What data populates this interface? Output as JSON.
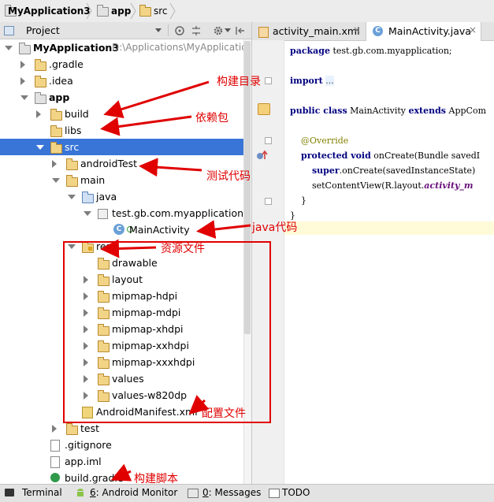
{
  "breadcrumb": [
    "MyApplication3",
    "app",
    "src"
  ],
  "panel": {
    "title": "Project"
  },
  "tree": [
    {
      "label": "MyApplication3",
      "path": "D:\\Applications\\MyApplication",
      "indent": 0,
      "arrow": "down",
      "icon": "folder-module",
      "bold": true
    },
    {
      "label": ".gradle",
      "indent": 1,
      "arrow": "right",
      "icon": "folder"
    },
    {
      "label": ".idea",
      "indent": 1,
      "arrow": "right",
      "icon": "folder"
    },
    {
      "label": "app",
      "indent": 1,
      "arrow": "down",
      "icon": "folder-module",
      "bold": true
    },
    {
      "label": "build",
      "indent": 2,
      "arrow": "right",
      "icon": "folder"
    },
    {
      "label": "libs",
      "indent": 2,
      "arrow": "none",
      "icon": "folder"
    },
    {
      "label": "src",
      "indent": 2,
      "arrow": "down",
      "icon": "folder",
      "selected": true
    },
    {
      "label": "androidTest",
      "indent": 3,
      "arrow": "right",
      "icon": "folder"
    },
    {
      "label": "main",
      "indent": 3,
      "arrow": "down",
      "icon": "folder"
    },
    {
      "label": "java",
      "indent": 4,
      "arrow": "down",
      "icon": "folder-blue"
    },
    {
      "label": "test.gb.com.myapplication",
      "indent": 5,
      "arrow": "down",
      "icon": "package"
    },
    {
      "label": "MainActivity",
      "indent": 6,
      "arrow": "none",
      "icon": "class"
    },
    {
      "label": "res",
      "indent": 4,
      "arrow": "down",
      "icon": "folder-res"
    },
    {
      "label": "drawable",
      "indent": 5,
      "arrow": "none",
      "icon": "folder"
    },
    {
      "label": "layout",
      "indent": 5,
      "arrow": "right",
      "icon": "folder"
    },
    {
      "label": "mipmap-hdpi",
      "indent": 5,
      "arrow": "right",
      "icon": "folder"
    },
    {
      "label": "mipmap-mdpi",
      "indent": 5,
      "arrow": "right",
      "icon": "folder"
    },
    {
      "label": "mipmap-xhdpi",
      "indent": 5,
      "arrow": "right",
      "icon": "folder"
    },
    {
      "label": "mipmap-xxhdpi",
      "indent": 5,
      "arrow": "right",
      "icon": "folder"
    },
    {
      "label": "mipmap-xxxhdpi",
      "indent": 5,
      "arrow": "right",
      "icon": "folder"
    },
    {
      "label": "values",
      "indent": 5,
      "arrow": "right",
      "icon": "folder"
    },
    {
      "label": "values-w820dp",
      "indent": 5,
      "arrow": "right",
      "icon": "folder"
    },
    {
      "label": "AndroidManifest.xml",
      "indent": 4,
      "arrow": "none",
      "icon": "manifest"
    },
    {
      "label": "test",
      "indent": 3,
      "arrow": "right",
      "icon": "folder"
    },
    {
      "label": ".gitignore",
      "indent": 2,
      "arrow": "none",
      "icon": "file"
    },
    {
      "label": "app.iml",
      "indent": 2,
      "arrow": "none",
      "icon": "file"
    },
    {
      "label": "build.gradle",
      "indent": 2,
      "arrow": "none",
      "icon": "gradle"
    }
  ],
  "editor": {
    "tabs": [
      {
        "label": "activity_main.xml",
        "active": false
      },
      {
        "label": "MainActivity.java",
        "active": true
      }
    ],
    "lines": [
      [
        {
          "t": "package",
          "c": "kw"
        },
        {
          "t": " test.gb.com.myapplication;"
        }
      ],
      [],
      [
        {
          "t": "import",
          "c": "kw"
        },
        {
          "t": " "
        },
        {
          "t": "...",
          "c": "fold-hint"
        }
      ],
      [],
      [
        {
          "t": "public class",
          "c": "kw"
        },
        {
          "t": " MainActivity "
        },
        {
          "t": "extends",
          "c": "kw"
        },
        {
          "t": " AppCom"
        }
      ],
      [],
      [
        {
          "t": "    @Override",
          "c": "ann"
        }
      ],
      [
        {
          "t": "    "
        },
        {
          "t": "protected void",
          "c": "kw"
        },
        {
          "t": " onCreate(Bundle savedI"
        }
      ],
      [
        {
          "t": "        "
        },
        {
          "t": "super",
          "c": "kw"
        },
        {
          "t": ".onCreate(savedInstanceState)"
        }
      ],
      [
        {
          "t": "        setContentView(R.layout."
        },
        {
          "t": "activity_m",
          "c": "fld"
        }
      ],
      [
        {
          "t": "    }"
        }
      ],
      [
        {
          "t": "}"
        }
      ]
    ]
  },
  "bottom_bar": [
    {
      "label": "Terminal",
      "icon": "terminal-icon"
    },
    {
      "mnemonic": "6",
      "label": ": Android Monitor",
      "icon": "android-icon"
    },
    {
      "mnemonic": "0",
      "label": ": Messages",
      "icon": "messages-icon"
    },
    {
      "label": "TODO",
      "icon": "todo-icon"
    }
  ],
  "annotations": {
    "build_dir": "构建目录",
    "deps": "依赖包",
    "test_code": "测试代码",
    "java_code": "java代码",
    "res_files": "资源文件",
    "config_file": "配置文件",
    "build_script": "构建脚本"
  },
  "colors": {
    "annotation": "#e00000",
    "selection": "#3875d7",
    "keyword": "#000080"
  }
}
